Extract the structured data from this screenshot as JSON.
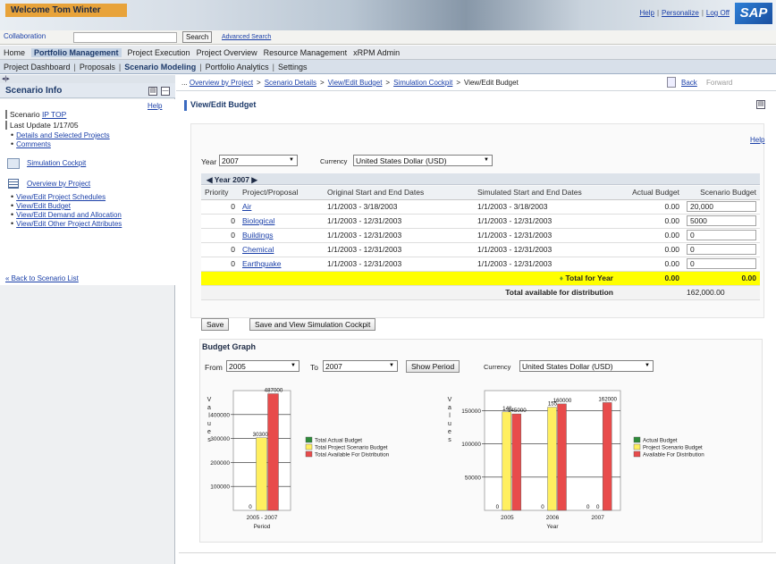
{
  "header": {
    "welcome": "Welcome Tom Winter",
    "links": [
      "Help",
      "Personalize",
      "Log Off"
    ],
    "logo": "SAP"
  },
  "toolbar": {
    "collaboration": "Collaboration",
    "search_button": "Search",
    "advanced_search": "Advanced Search"
  },
  "top_nav": [
    "Home",
    "Portfolio Management",
    "Project Execution",
    "Project Overview",
    "Resource Management",
    "xRPM Admin"
  ],
  "top_nav_active": "Portfolio Management",
  "sub_nav": [
    "Project Dashboard",
    "Proposals",
    "Scenario Modeling",
    "Portfolio Analytics",
    "Settings"
  ],
  "sub_nav_active": "Scenario Modeling",
  "left_panel": {
    "title": "Scenario Info",
    "help": "Help",
    "scenario_label": "Scenario",
    "scenario_link": "IP TOP",
    "last_update": "Last Update 1/17/05",
    "links_top": [
      "Details and Selected Projects",
      "Comments"
    ],
    "simulation_cockpit": "Simulation Cockpit",
    "overview_by_project": "Overview by Project",
    "links_bottom": [
      "View/Edit Project Schedules",
      "View/Edit Budget",
      "View/Edit Demand and Allocation",
      "View/Edit Other Project Attributes"
    ],
    "back": "« Back to Scenario List"
  },
  "breadcrumb": {
    "prefix": "...",
    "items": [
      "Overview by Project",
      "Scenario Details",
      "View/Edit Budget",
      "Simulation Cockpit"
    ],
    "current": "View/Edit Budget",
    "back": "Back",
    "forward": "Forward"
  },
  "page_title": "View/Edit Budget",
  "help": "Help",
  "filters": {
    "year_label": "Year",
    "year_value": "2007",
    "currency_label": "Currency",
    "currency_value": "United States Dollar (USD)"
  },
  "year_band": "Year 2007",
  "table": {
    "columns": [
      "Priority",
      "Project/Proposal",
      "Original Start and End Dates",
      "Simulated Start and End Dates",
      "Actual Budget",
      "Scenario Budget"
    ],
    "rows": [
      {
        "priority": "0",
        "project": "Air",
        "original": "1/1/2003 - 3/18/2003",
        "simulated": "1/1/2003 - 3/18/2003",
        "actual": "0.00",
        "scenario": "20,000"
      },
      {
        "priority": "0",
        "project": "Biological",
        "original": "1/1/2003 - 12/31/2003",
        "simulated": "1/1/2003 - 12/31/2003",
        "actual": "0.00",
        "scenario": "5000"
      },
      {
        "priority": "0",
        "project": "Buildings",
        "original": "1/1/2003 - 12/31/2003",
        "simulated": "1/1/2003 - 12/31/2003",
        "actual": "0.00",
        "scenario": "0"
      },
      {
        "priority": "0",
        "project": "Chemical",
        "original": "1/1/2003 - 12/31/2003",
        "simulated": "1/1/2003 - 12/31/2003",
        "actual": "0.00",
        "scenario": "0"
      },
      {
        "priority": "0",
        "project": "Earthquake",
        "original": "1/1/2003 - 12/31/2003",
        "simulated": "1/1/2003 - 12/31/2003",
        "actual": "0.00",
        "scenario": "0"
      }
    ],
    "total_label": "Total for Year",
    "total_actual": "0.00",
    "total_scenario": "0.00",
    "available_label": "Total available for distribution",
    "available_value": "162,000.00"
  },
  "buttons": {
    "save": "Save",
    "save_view": "Save and View Simulation Cockpit"
  },
  "graph": {
    "title": "Budget Graph",
    "from_label": "From",
    "from_value": "2005",
    "to_label": "To",
    "to_value": "2007",
    "show_period": "Show Period",
    "currency_label": "Currency",
    "currency_value": "United States Dollar (USD)"
  },
  "chart_data": [
    {
      "type": "bar",
      "ylabel": "Values",
      "xlabel": "Period",
      "categories": [
        "2005 - 2007"
      ],
      "ylim": [
        0,
        500000
      ],
      "yticks": [
        "100000",
        "200000",
        "300000",
        "400000"
      ],
      "grid": true,
      "legend": "right",
      "series": [
        {
          "name": "Total Actual Budget",
          "color": "#2e8b3a",
          "values": [
            0
          ]
        },
        {
          "name": "Total Project Scenario Budget",
          "color": "#ffef60",
          "values": [
            303000
          ]
        },
        {
          "name": "Total Available For Distribution",
          "color": "#e84b4b",
          "values": [
            487000
          ]
        }
      ],
      "data_labels": [
        [
          "0"
        ],
        [
          "303000"
        ],
        [
          "487000"
        ]
      ]
    },
    {
      "type": "bar",
      "ylabel": "Values",
      "xlabel": "Year",
      "categories": [
        "2005",
        "2006",
        "2007"
      ],
      "ylim": [
        0,
        180000
      ],
      "yticks": [
        "50000",
        "100000",
        "150000"
      ],
      "grid": true,
      "legend": "right",
      "series": [
        {
          "name": "Actual Budget",
          "color": "#2e8b3a",
          "values": [
            0,
            0,
            0
          ]
        },
        {
          "name": "Project Scenario Budget",
          "color": "#ffef60",
          "values": [
            148000,
            155000,
            0
          ]
        },
        {
          "name": "Available For Distribution",
          "color": "#e84b4b",
          "values": [
            145000,
            160000,
            162000
          ]
        }
      ],
      "data_labels": [
        [
          "0",
          "0",
          "0"
        ],
        [
          "148",
          "155",
          "0"
        ],
        [
          "145000",
          "160000",
          "162000"
        ]
      ]
    }
  ]
}
